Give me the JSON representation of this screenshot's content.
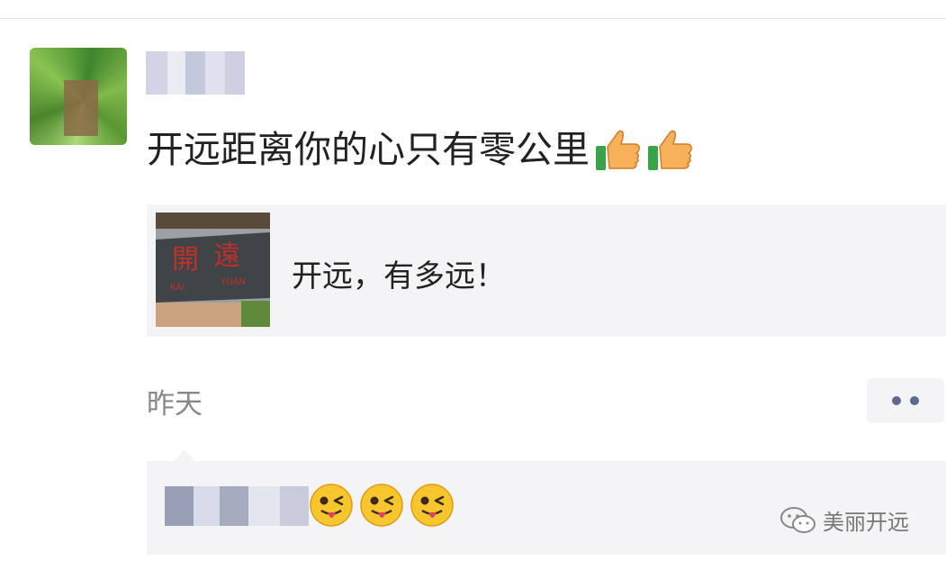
{
  "post": {
    "text": "开远距离你的心只有零公里",
    "link": {
      "title": "开远，有多远！",
      "thumbnail_sign": {
        "chars": [
          "開",
          "遠"
        ],
        "latin": [
          "KAI",
          "YUAN"
        ]
      }
    },
    "time": "昨天"
  },
  "icons": {
    "thumbs": [
      "thumbs-up-icon",
      "thumbs-up-icon"
    ],
    "emojis": [
      "tongue-wink-icon",
      "tongue-wink-icon",
      "tongue-wink-icon"
    ],
    "more": "more-dots-icon",
    "watermark": "wechat-icon"
  },
  "watermark": {
    "text": "美丽开远"
  },
  "colors": {
    "dots": "#5b6a8d",
    "card_bg": "#f4f4f6",
    "time_text": "#888888"
  }
}
